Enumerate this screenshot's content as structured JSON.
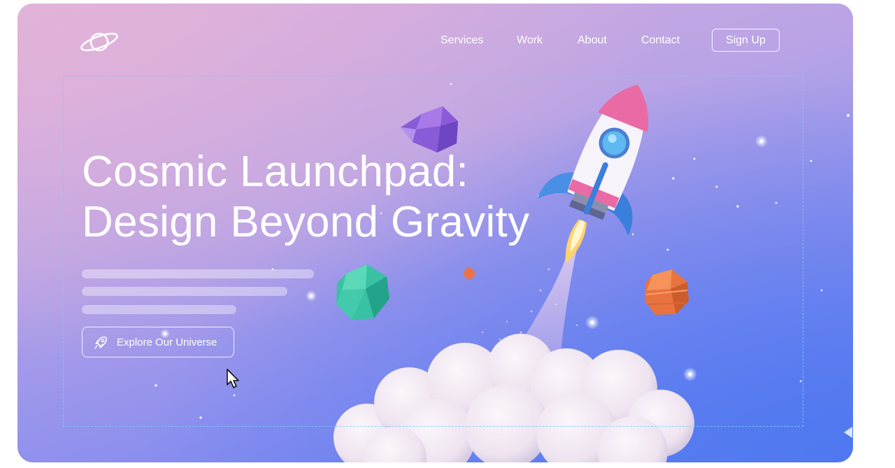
{
  "nav": {
    "logo_icon": "planet-ring-icon",
    "links": [
      "Services",
      "Work",
      "About",
      "Contact"
    ],
    "signup_label": "Sign Up"
  },
  "hero": {
    "headline_line1": "Cosmic Launchpad:",
    "headline_line2": "Design Beyond Gravity",
    "cta_label": "Explore Our Universe",
    "cta_icon": "rocket-icon"
  },
  "colors": {
    "gradient_top_left": "#e2b3d9",
    "gradient_mid": "#b7a3e6",
    "gradient_bottom_right": "#5f80f2",
    "text": "#ffffff",
    "guide": "#78cdf5"
  }
}
